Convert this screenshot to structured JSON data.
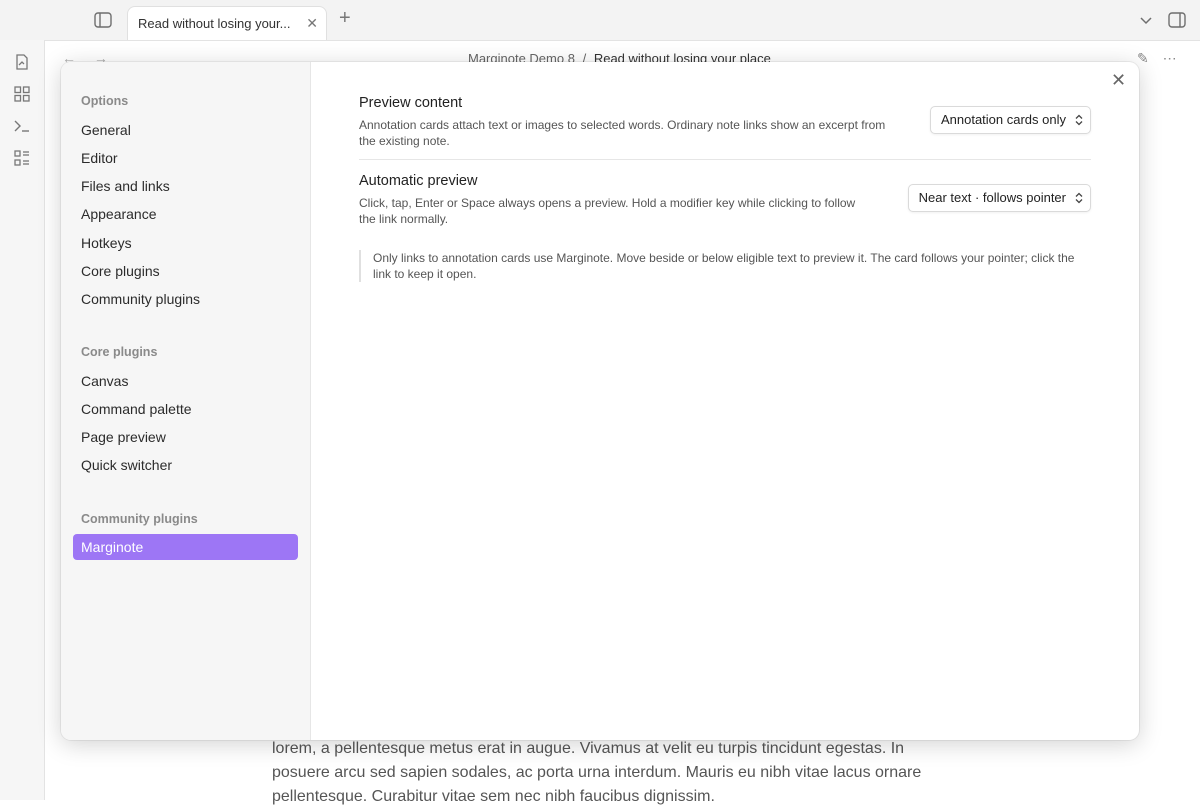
{
  "titlebar": {
    "tab_title": "Read without losing your...",
    "tab_close": "✕",
    "new_tab": "+"
  },
  "editor": {
    "nav_back": "←",
    "nav_forward": "→",
    "breadcrumb_parent": "Marginote Demo 8",
    "breadcrumb_sep": "/",
    "breadcrumb_current": "Read without losing your place",
    "edit_icon": "✎",
    "more_icon": "⋯",
    "body_text": "lorem, a pellentesque metus erat in augue. Vivamus at velit eu turpis tincidunt egestas. In posuere arcu sed sapien sodales, ac porta urna interdum. Mauris eu nibh vitae lacus ornare pellentesque. Curabitur vitae sem nec nibh faucibus dignissim."
  },
  "settings": {
    "close": "✕",
    "sidebar": {
      "options_heading": "Options",
      "options": [
        "General",
        "Editor",
        "Files and links",
        "Appearance",
        "Hotkeys",
        "Core plugins",
        "Community plugins"
      ],
      "core_heading": "Core plugins",
      "core": [
        "Canvas",
        "Command palette",
        "Page preview",
        "Quick switcher"
      ],
      "community_heading": "Community plugins",
      "community": [
        "Marginote"
      ]
    },
    "preview_content": {
      "title": "Preview content",
      "desc": "Annotation cards attach text or images to selected words. Ordinary note links show an excerpt from the existing note.",
      "value": "Annotation cards only"
    },
    "automatic_preview": {
      "title": "Automatic preview",
      "desc": "Click, tap, Enter or Space always opens a preview. Hold a modifier key while clicking to follow the link normally.",
      "value": "Near text · follows pointer"
    },
    "callout": "Only links to annotation cards use Marginote. Move beside or below eligible text to preview it. The card follows your pointer; click the link to keep it open."
  },
  "colors": {
    "accent": "#9d76f5"
  }
}
